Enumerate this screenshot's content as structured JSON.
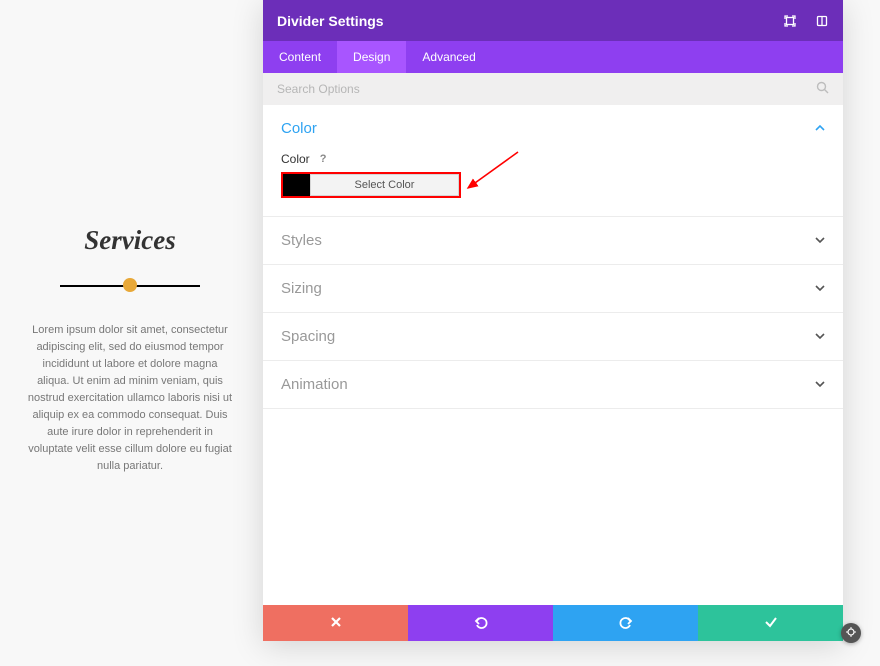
{
  "preview": {
    "heading": "Services",
    "body": "Lorem ipsum dolor sit amet, consectetur adipiscing elit, sed do eiusmod tempor incididunt ut labore et dolore magna aliqua. Ut enim ad minim veniam, quis nostrud exercitation ullamco laboris nisi ut aliquip ex ea commodo consequat. Duis aute irure dolor in reprehenderit in voluptate velit esse cillum dolore eu fugiat nulla pariatur."
  },
  "panel": {
    "title": "Divider Settings",
    "tabs": {
      "content": "Content",
      "design": "Design",
      "advanced": "Advanced"
    },
    "search_placeholder": "Search Options",
    "sections": {
      "color": {
        "title": "Color",
        "field_label": "Color",
        "help": "?",
        "button": "Select Color",
        "swatch_value": "#000000"
      },
      "styles": "Styles",
      "sizing": "Sizing",
      "spacing": "Spacing",
      "animation": "Animation"
    }
  }
}
